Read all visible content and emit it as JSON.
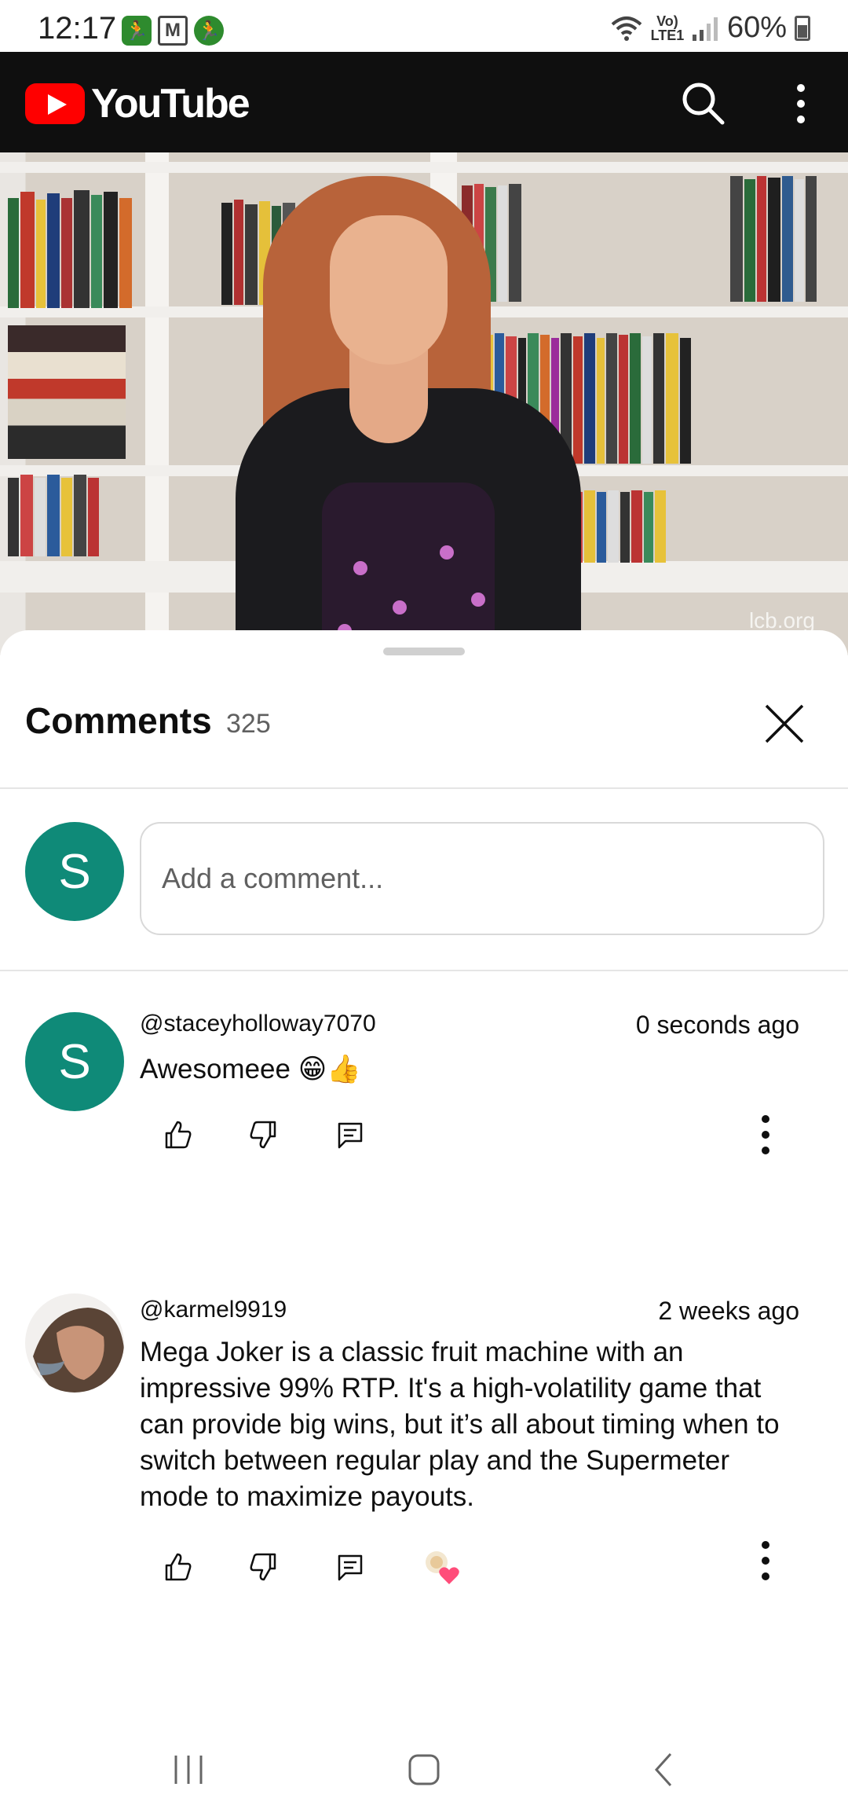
{
  "status_bar": {
    "time": "12:17",
    "network_label": "Vo) LTE1",
    "battery_percent": "60%",
    "icons": [
      "fitness-app-icon",
      "gmail-icon",
      "fitness-app-icon",
      "wifi-icon",
      "signal-icon",
      "battery-icon"
    ]
  },
  "header": {
    "brand": "YouTube",
    "icons": [
      "youtube-play-icon",
      "search-icon",
      "more-vert-icon"
    ]
  },
  "video": {
    "watermark": "lcb.org"
  },
  "comments": {
    "title": "Comments",
    "count": "325",
    "add_placeholder": "Add a comment...",
    "current_user_initial": "S",
    "items": [
      {
        "avatar_initial": "S",
        "handle": "@staceyholloway7070",
        "time": "0 seconds ago",
        "text": "Awesomeee 😁👍"
      },
      {
        "handle": "@karmel9919",
        "time": "2 weeks ago",
        "text": "Mega Joker is a classic fruit machine with an impressive 99% RTP. It's a high-volatility game that can provide big wins, but it’s all about timing when to switch between regular play and the Supermeter mode to maximize payouts."
      }
    ]
  },
  "colors": {
    "youtube_red": "#ff0000",
    "header_bg": "#0f0f0f",
    "avatar_teal": "#0f8a78"
  }
}
